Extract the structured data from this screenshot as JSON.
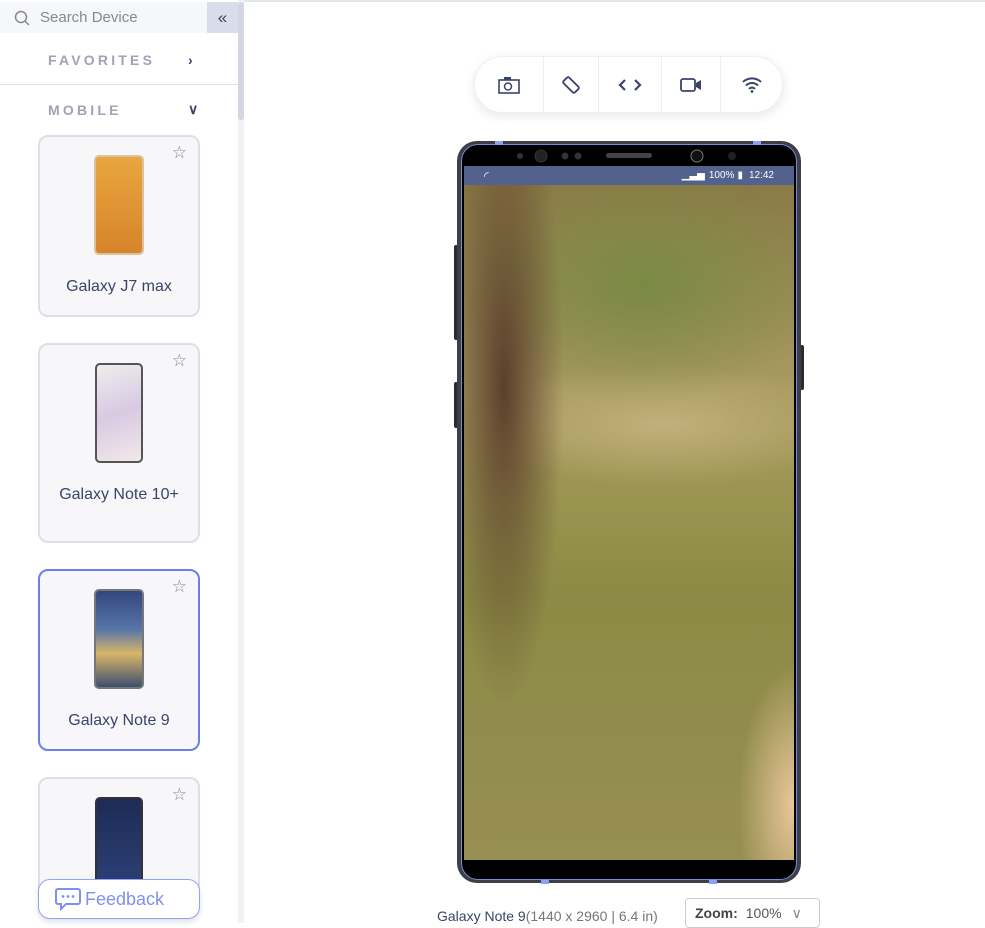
{
  "sidebar": {
    "search_placeholder": "Search Device",
    "collapse_icon": "double-chevron-left",
    "sections": [
      {
        "label": "FAVORITES",
        "state": "collapsed"
      },
      {
        "label": "MOBILE",
        "state": "expanded"
      }
    ],
    "devices": [
      {
        "name": "Galaxy J7 max",
        "selected": false
      },
      {
        "name": "Galaxy Note 10+",
        "selected": false
      },
      {
        "name": "Galaxy Note 9",
        "selected": true
      },
      {
        "name": "",
        "selected": false
      }
    ],
    "feedback_label": "Feedback"
  },
  "toolbar": {
    "icons": [
      "camera-icon",
      "rotate-icon",
      "code-icon",
      "video-icon",
      "wifi-icon"
    ]
  },
  "device": {
    "status_time": "12:42",
    "status_battery": "100%",
    "name": "Galaxy Note 9",
    "spec": "(1440 x 2960 | 6.4 in)"
  },
  "zoom": {
    "label": "Zoom:",
    "value": "100%"
  },
  "colors": {
    "accent": "#6b80e6",
    "status_bar": "#52628c",
    "text": "#3a4468"
  }
}
